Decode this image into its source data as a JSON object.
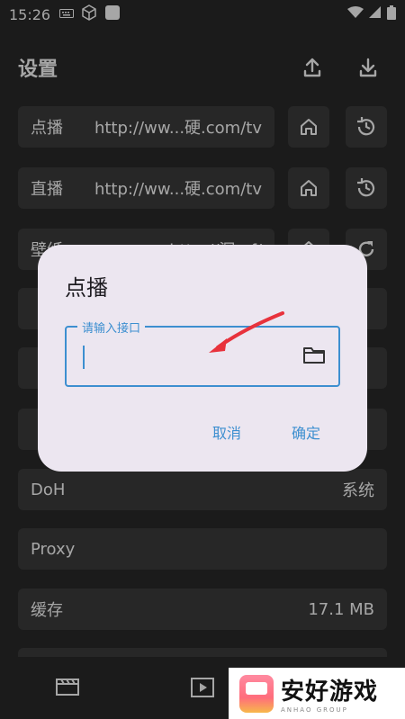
{
  "status_bar": {
    "time": "15:26"
  },
  "header": {
    "title": "设置"
  },
  "rows": {
    "vod": {
      "label": "点播",
      "value": "http://ww...硬.com/tv"
    },
    "live": {
      "label": "直播",
      "value": "http://ww...硬.com/tv"
    },
    "wallpaper": {
      "label": "壁纸",
      "value": "http://深...f/"
    },
    "doh": {
      "label": "DoH",
      "value": "系统"
    },
    "proxy": {
      "label": "Proxy"
    },
    "cache": {
      "label": "缓存",
      "value": "17.1 MB"
    }
  },
  "dialog": {
    "title": "点播",
    "input_label": "请输入接口",
    "input_value": "",
    "cancel": "取消",
    "confirm": "确定"
  },
  "watermark": {
    "brand": "安好游戏",
    "sub": "ANHAO GROUP"
  },
  "colors": {
    "accent": "#3d8fd0",
    "dialog_bg": "#ece6f0",
    "arrow": "#e8323c"
  }
}
